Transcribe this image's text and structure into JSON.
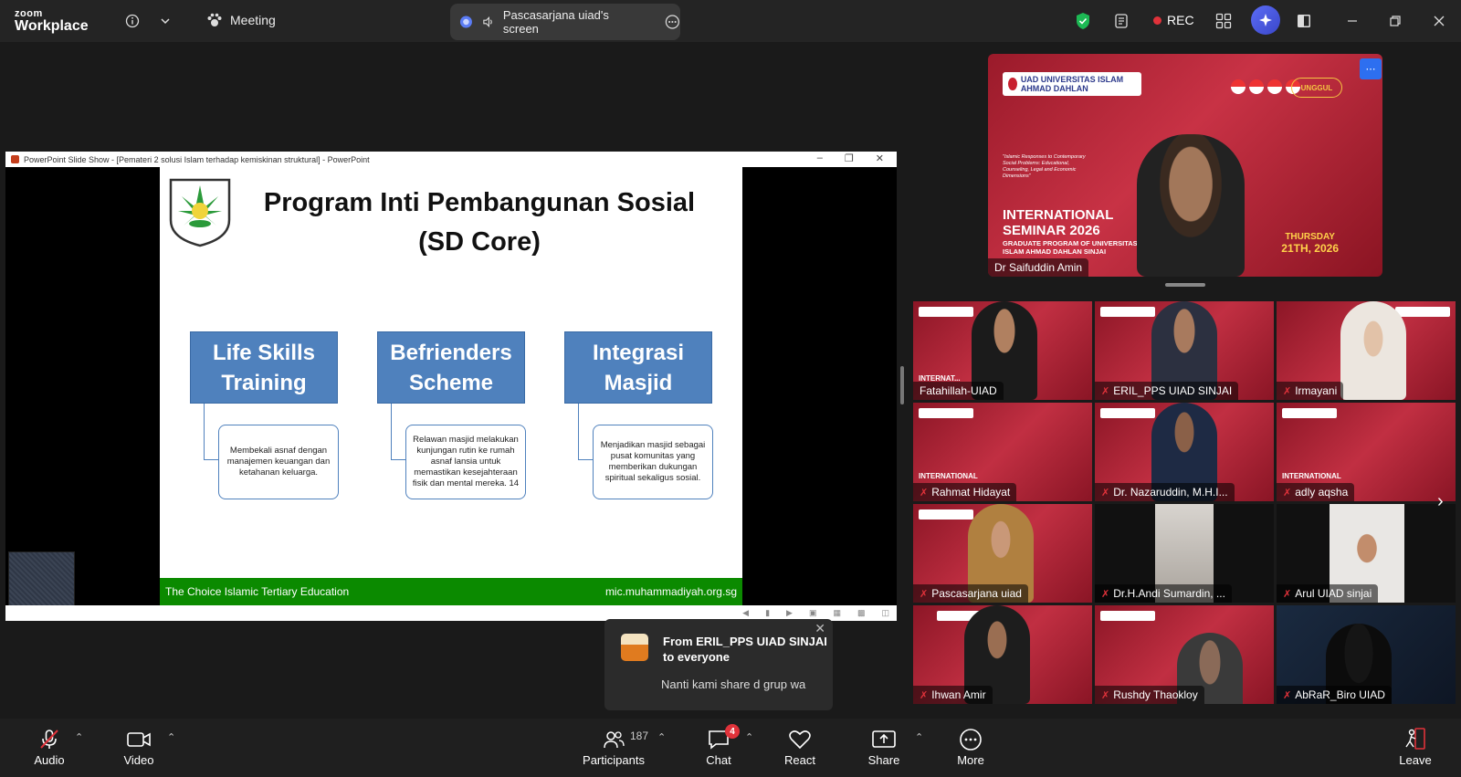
{
  "topbar": {
    "logo_line1": "zoom",
    "logo_line2": "Workplace",
    "meeting_label": "Meeting",
    "share_label": "Pascasarjana uiad's screen",
    "rec_label": "REC"
  },
  "ppt": {
    "window_title": "PowerPoint Slide Show - [Pemateri 2 solusi Islam terhadap kemiskinan struktural] - PowerPoint",
    "slide_title_line1": "Program Inti Pembangunan Sosial",
    "slide_title_line2": "(SD Core)",
    "boxes": [
      {
        "heading_l1": "Life Skills",
        "heading_l2": "Training",
        "text": "Membekali asnaf dengan manajemen keuangan dan ketahanan keluarga."
      },
      {
        "heading_l1": "Befrienders",
        "heading_l2": "Scheme",
        "text": "Relawan masjid melakukan kunjungan rutin ke rumah asnaf lansia untuk memastikan kesejahteraan fisik dan mental mereka. 14"
      },
      {
        "heading_l1": "Integrasi",
        "heading_l2": "Masjid",
        "text": "Menjadikan masjid sebagai pusat komunitas yang memberikan dukungan spiritual sekaligus sosial."
      }
    ],
    "footer_left": "The Choice Islamic Tertiary Education",
    "footer_right": "mic.muhammadiyah.org.sg"
  },
  "speaker": {
    "name": "Dr Saifuddin Amin",
    "banner": "UAD UNIVERSITAS ISLAM AHMAD DAHLAN",
    "quote": "\"Islamic Responses to Contemporary Social Problems: Educational, Counseling, Legal and Economic Dimensions\"",
    "seminar_l1": "INTERNATIONAL",
    "seminar_l2": "SEMINAR 2026",
    "seminar_sub_l1": "GRADUATE PROGRAM OF UNIVERSITAS",
    "seminar_sub_l2": "ISLAM AHMAD DAHLAN SINJAI",
    "date_day": "THURSDAY",
    "date": "21TH, 2026",
    "unggul": "UNGGUL"
  },
  "participants": [
    {
      "name": "Fatahillah-UIAD",
      "muted": false
    },
    {
      "name": "ERIL_PPS UIAD SINJAI",
      "muted": true
    },
    {
      "name": "Irmayani",
      "muted": true
    },
    {
      "name": "Rahmat Hidayat",
      "muted": true
    },
    {
      "name": "Dr. Nazaruddin, M.H.I...",
      "muted": true
    },
    {
      "name": "adly aqsha",
      "muted": true
    },
    {
      "name": "Pascasarjana uiad",
      "muted": true
    },
    {
      "name": "Dr.H.Andi Sumardin, ...",
      "muted": true
    },
    {
      "name": "Arul UIAD sinjai",
      "muted": true
    },
    {
      "name": "Ihwan Amir",
      "muted": true
    },
    {
      "name": "Rushdy Thaokloy",
      "muted": true
    },
    {
      "name": "AbRaR_Biro UIAD",
      "muted": true
    }
  ],
  "chat_popup": {
    "from_l1": "From ERIL_PPS UIAD SINJAI",
    "from_l2": "to everyone",
    "message": "Nanti kami share d grup wa"
  },
  "toolbar": {
    "audio": "Audio",
    "video": "Video",
    "participants": "Participants",
    "participants_count": "187",
    "chat": "Chat",
    "chat_badge": "4",
    "react": "React",
    "share": "Share",
    "more": "More",
    "leave": "Leave"
  },
  "colors": {
    "slide_box": "#4f81bd",
    "footer_green": "#0b8a00",
    "rec_red": "#e0323a",
    "seminar_red": "#c12f42"
  }
}
